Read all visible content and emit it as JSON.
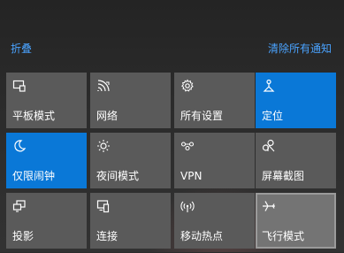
{
  "header": {
    "collapse_label": "折叠",
    "clear_all_label": "清除所有通知"
  },
  "colors": {
    "accent": "#0a78d7",
    "link": "#4aa3ff",
    "tile": "#5a5a5a",
    "tile_hover": "#747474"
  },
  "tiles": [
    {
      "label": "平板模式",
      "icon": "tablet-mode-icon",
      "state": "off"
    },
    {
      "label": "网络",
      "icon": "network-icon",
      "state": "off"
    },
    {
      "label": "所有设置",
      "icon": "settings-icon",
      "state": "off"
    },
    {
      "label": "定位",
      "icon": "location-icon",
      "state": "on"
    },
    {
      "label": "仅限闹钟",
      "icon": "focus-assist-moon-icon",
      "state": "on"
    },
    {
      "label": "夜间模式",
      "icon": "night-light-icon",
      "state": "off"
    },
    {
      "label": "VPN",
      "icon": "vpn-icon",
      "state": "off"
    },
    {
      "label": "屏幕截图",
      "icon": "screen-snip-icon",
      "state": "off"
    },
    {
      "label": "投影",
      "icon": "project-icon",
      "state": "off"
    },
    {
      "label": "连接",
      "icon": "connect-icon",
      "state": "off"
    },
    {
      "label": "移动热点",
      "icon": "mobile-hotspot-icon",
      "state": "off"
    },
    {
      "label": "飞行模式",
      "icon": "airplane-mode-icon",
      "state": "hover"
    }
  ]
}
